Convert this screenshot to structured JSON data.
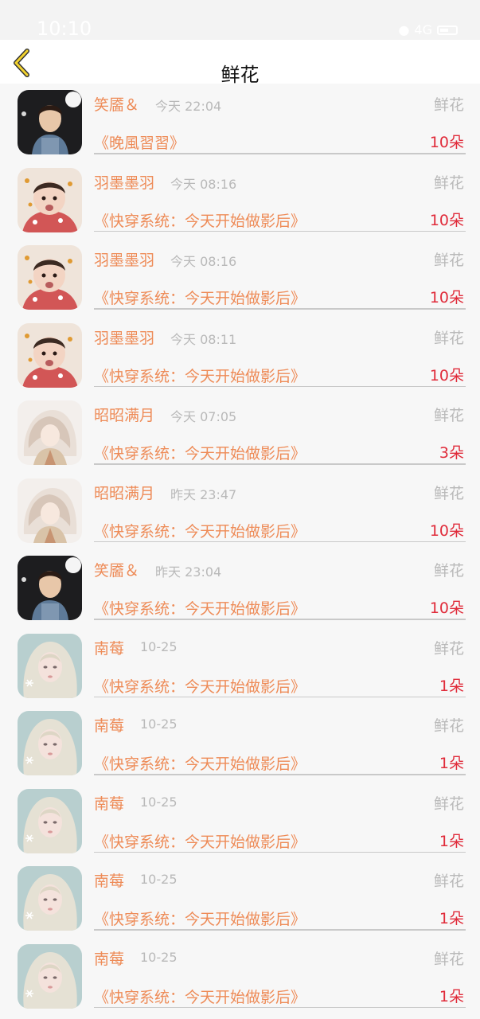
{
  "status_bar": {
    "time": "10:10",
    "network": "4G"
  },
  "nav": {
    "title": "鲜花"
  },
  "records": [
    {
      "name": "笑靥＆",
      "time": "今天 22:04",
      "type": "鲜花",
      "book": "《晚風習習》",
      "amount": "10朵",
      "avatar": "man"
    },
    {
      "name": "羽墨墨羽",
      "time": "今天 08:16",
      "type": "鲜花",
      "book": "《快穿系统：今天开始做影后》",
      "amount": "10朵",
      "avatar": "baby"
    },
    {
      "name": "羽墨墨羽",
      "time": "今天 08:16",
      "type": "鲜花",
      "book": "《快穿系统：今天开始做影后》",
      "amount": "10朵",
      "avatar": "baby"
    },
    {
      "name": "羽墨墨羽",
      "time": "今天 08:11",
      "type": "鲜花",
      "book": "《快穿系统：今天开始做影后》",
      "amount": "10朵",
      "avatar": "baby"
    },
    {
      "name": "昭昭满月",
      "time": "今天 07:05",
      "type": "鲜花",
      "book": "《快穿系统：今天开始做影后》",
      "amount": "3朵",
      "avatar": "anime"
    },
    {
      "name": "昭昭满月",
      "time": "昨天 23:47",
      "type": "鲜花",
      "book": "《快穿系统：今天开始做影后》",
      "amount": "10朵",
      "avatar": "anime"
    },
    {
      "name": "笑靥＆",
      "time": "昨天 23:04",
      "type": "鲜花",
      "book": "《快穿系统：今天开始做影后》",
      "amount": "10朵",
      "avatar": "man"
    },
    {
      "name": "南莓",
      "time": "10-25",
      "type": "鲜花",
      "book": "《快穿系统：今天开始做影后》",
      "amount": "1朵",
      "avatar": "girl"
    },
    {
      "name": "南莓",
      "time": "10-25",
      "type": "鲜花",
      "book": "《快穿系统：今天开始做影后》",
      "amount": "1朵",
      "avatar": "girl"
    },
    {
      "name": "南莓",
      "time": "10-25",
      "type": "鲜花",
      "book": "《快穿系统：今天开始做影后》",
      "amount": "1朵",
      "avatar": "girl"
    },
    {
      "name": "南莓",
      "time": "10-25",
      "type": "鲜花",
      "book": "《快穿系统：今天开始做影后》",
      "amount": "1朵",
      "avatar": "girl"
    },
    {
      "name": "南莓",
      "time": "10-25",
      "type": "鲜花",
      "book": "《快穿系统：今天开始做影后》",
      "amount": "1朵",
      "avatar": "girl"
    }
  ]
}
